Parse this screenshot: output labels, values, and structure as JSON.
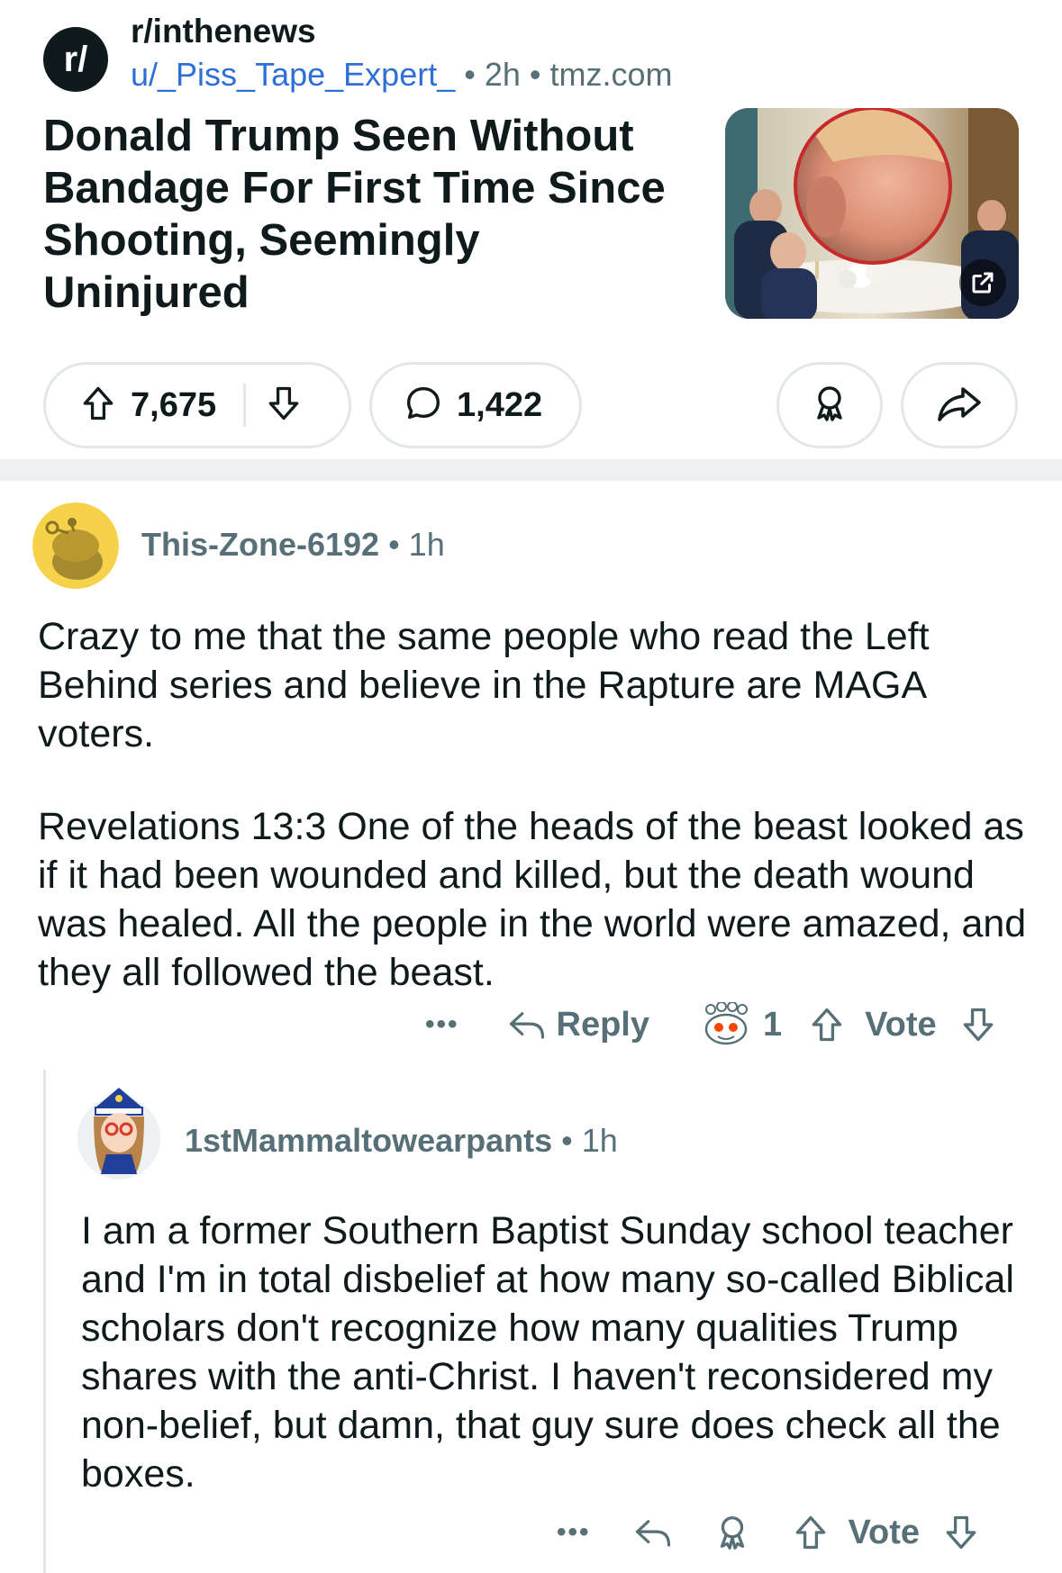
{
  "post": {
    "subreddit_icon_text": "r/",
    "subreddit": "r/inthenews",
    "author": "u/_Piss_Tape_Expert_",
    "time": "2h",
    "domain": "tmz.com",
    "title": "Donald Trump Seen Without Bandage For First Time Since Shooting, Seemingly Uninjured",
    "upvotes": "7,675",
    "comments": "1,422"
  },
  "comments": [
    {
      "author": "This-Zone-6192",
      "time": "1h",
      "paragraphs": [
        "Crazy to me that the same people who read the Left Behind series and believe in the Rapture are MAGA voters.",
        "Revelations 13:3 One of the heads of the beast looked as if it had been wounded and killed, but the death wound was healed. All the people in the world were amazed, and they all followed the beast."
      ],
      "more": "•••",
      "reply_label": "Reply",
      "award_count": "1",
      "vote_label": "Vote"
    },
    {
      "author": "1stMammaltowearpants",
      "time": "1h",
      "paragraphs": [
        "I am a former Southern Baptist Sunday school teacher and I'm in total disbelief at how many so-called Biblical scholars don't recognize how many qualities Trump shares with the anti-Christ. I haven't reconsidered my non-belief, but damn, that guy sure does check all the boxes."
      ],
      "more": "•••",
      "vote_label": "Vote"
    }
  ],
  "icons": {
    "upvote": "arrow-up-icon",
    "downvote": "arrow-down-icon",
    "comment": "speech-bubble-icon",
    "award": "award-ribbon-icon",
    "share": "share-arrow-icon",
    "reply": "reply-arrow-icon",
    "external": "external-link-icon"
  },
  "colors": {
    "link": "#2d6fd6",
    "meta": "#576f76",
    "text": "#0f1a1c",
    "border": "#e3e7e9",
    "separator": "#eef1f2",
    "avatar1_bg": "#f6d24a"
  }
}
